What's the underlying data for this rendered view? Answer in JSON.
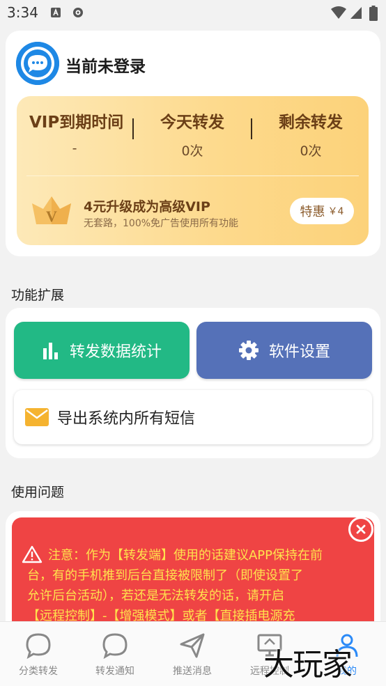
{
  "status_bar": {
    "time": "3:34"
  },
  "profile": {
    "login_status": "当前未登录",
    "stats": [
      {
        "label": "VIP到期时间",
        "value": "-"
      },
      {
        "label": "今天转发",
        "value": "0次"
      },
      {
        "label": "剩余转发",
        "value": "0次"
      }
    ],
    "upgrade": {
      "crown_letter": "V",
      "title": "4元升级成为高级VIP",
      "subtitle": "无套路，100%免广告使用所有功能",
      "price_label": "特惠",
      "price_value": "￥4"
    }
  },
  "functions": {
    "section_title": "功能扩展",
    "stats_button": "转发数据统计",
    "settings_button": "软件设置",
    "export_label": "导出系统内所有短信",
    "colors": {
      "stats": "#22b985",
      "settings": "#5571b8"
    }
  },
  "usage": {
    "section_title": "使用问题",
    "alert_lines": [
      "注意：作为【转发端】使用的话建议APP保持在前",
      "台，有的手机推到后台直接被限制了（即使设置了",
      "允许后台活动），若还是无法转发的话，请开启",
      "【远程控制】-【增强模式】或者【直接插电源充"
    ]
  },
  "bottom_nav": {
    "items": [
      {
        "label": "分类转发",
        "icon": "chat-bubble-icon"
      },
      {
        "label": "转发通知",
        "icon": "chat-bubble-icon"
      },
      {
        "label": "推送消息",
        "icon": "send-icon"
      },
      {
        "label": "远程控制",
        "icon": "remote-desktop-icon"
      },
      {
        "label": "我的",
        "icon": "person-icon"
      }
    ],
    "active_index": 4,
    "active_color": "#2b8af7"
  },
  "watermark": "大玩家"
}
